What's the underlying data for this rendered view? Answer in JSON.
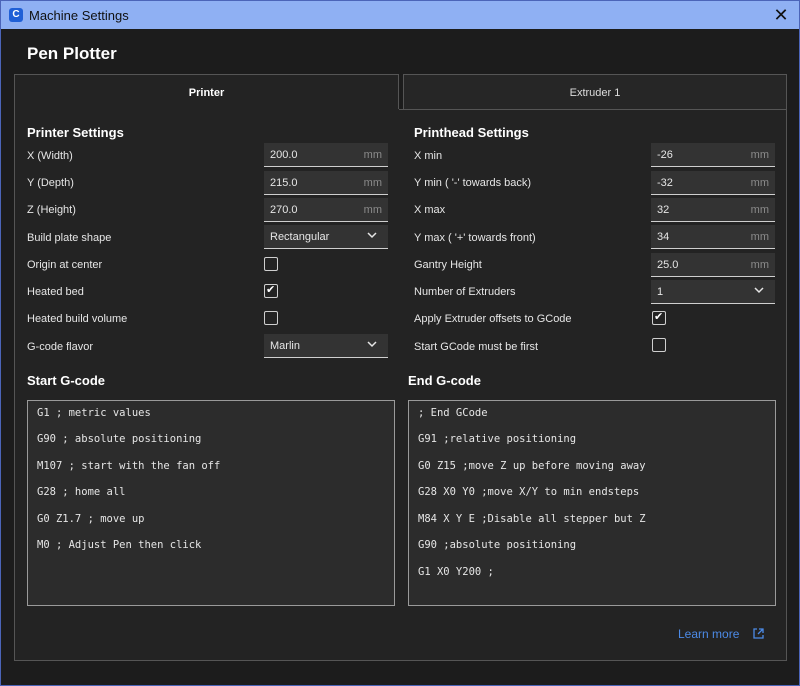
{
  "window": {
    "title": "Machine Settings",
    "close_glyph": "✕",
    "app_icon_letter": "C"
  },
  "heading": "Pen Plotter",
  "tabs": [
    {
      "label": "Printer",
      "active": true
    },
    {
      "label": "Extruder 1",
      "active": false
    }
  ],
  "printer_settings": {
    "title": "Printer Settings",
    "x_width": {
      "label": "X (Width)",
      "value": "200.0",
      "unit": "mm"
    },
    "y_depth": {
      "label": "Y (Depth)",
      "value": "215.0",
      "unit": "mm"
    },
    "z_height": {
      "label": "Z (Height)",
      "value": "270.0",
      "unit": "mm"
    },
    "build_plate_shape": {
      "label": "Build plate shape",
      "value": "Rectangular"
    },
    "origin_at_center": {
      "label": "Origin at center",
      "checked": false
    },
    "heated_bed": {
      "label": "Heated bed",
      "checked": true
    },
    "heated_build_volume": {
      "label": "Heated build volume",
      "checked": false
    },
    "gcode_flavor": {
      "label": "G-code flavor",
      "value": "Marlin"
    }
  },
  "printhead_settings": {
    "title": "Printhead Settings",
    "x_min": {
      "label": "X min",
      "value": "-26",
      "unit": "mm"
    },
    "y_min": {
      "label": "Y min ( '-' towards back)",
      "value": "-32",
      "unit": "mm"
    },
    "x_max": {
      "label": "X max",
      "value": "32",
      "unit": "mm"
    },
    "y_max": {
      "label": "Y max ( '+' towards front)",
      "value": "34",
      "unit": "mm"
    },
    "gantry_height": {
      "label": "Gantry Height",
      "value": "25.0",
      "unit": "mm"
    },
    "number_of_extruders": {
      "label": "Number of Extruders",
      "value": "1"
    },
    "apply_extruder_offsets": {
      "label": "Apply Extruder offsets to GCode",
      "checked": true
    },
    "start_gcode_first": {
      "label": "Start GCode must be first",
      "checked": false
    }
  },
  "start_gcode": {
    "title": "Start G-code",
    "lines": [
      "G1 ; metric values",
      "G90 ; absolute positioning",
      "M107 ; start with the fan off",
      "G28 ; home all",
      "G0 Z1.7 ; move up",
      "M0 ; Adjust Pen then click"
    ]
  },
  "end_gcode": {
    "title": "End G-code",
    "lines": [
      "; End GCode",
      "G91 ;relative positioning",
      "G0 Z15 ;move Z up before moving away",
      "G28 X0 Y0 ;move X/Y to min endsteps",
      "M84 X Y E ;Disable all stepper but Z",
      "G90 ;absolute positioning",
      "G1 X0 Y200 ;"
    ]
  },
  "learn_more": {
    "label": "Learn more",
    "icon": "external-link-icon"
  },
  "icons": {
    "chevron": "⌄",
    "check": "✔",
    "external": "⧉"
  },
  "colors": {
    "titlebar": "#8fb0f3",
    "link": "#4c8ae6",
    "background": "#1c1c1c"
  }
}
